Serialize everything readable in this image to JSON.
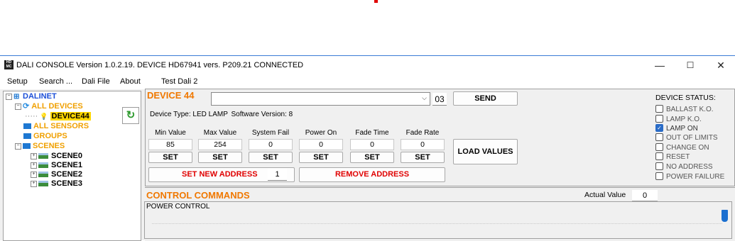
{
  "window": {
    "title": "DALI CONSOLE Version 1.0.2.19.  DEVICE HD67941     vers. P209.21 CONNECTED",
    "icon": "app-icon",
    "controls": {
      "minimize": "—",
      "maximize": "☐",
      "close": "✕"
    }
  },
  "menu": [
    "Setup",
    "Search ...",
    "Dali File",
    "About",
    "Test Dali 2"
  ],
  "tree": {
    "root": "DALINET",
    "all_devices": "ALL DEVICES",
    "device": "DEVICE44",
    "all_sensors": "ALL SENSORS",
    "groups": "GROUPS",
    "scenes": "SCENES",
    "scene_items": [
      "SCENE0",
      "SCENE1",
      "SCENE2",
      "SCENE3"
    ],
    "colors": {
      "root": "#1c4fd8",
      "group_label": "#f0a000",
      "selected_bg": "#ffd700"
    }
  },
  "device_panel": {
    "title": "DEVICE 44",
    "combo_value": "",
    "combo_number": "03",
    "send_label": "SEND",
    "device_type_label": "Device Type:",
    "device_type": "LED LAMP",
    "software_version_label": "Software Version:",
    "software_version": "8",
    "params": [
      {
        "label": "Min Value",
        "value": "85",
        "set": "SET"
      },
      {
        "label": "Max Value",
        "value": "254",
        "set": "SET"
      },
      {
        "label": "System Fail",
        "value": "0",
        "set": "SET"
      },
      {
        "label": "Power On",
        "value": "0",
        "set": "SET"
      },
      {
        "label": "Fade Time",
        "value": "0",
        "set": "SET"
      },
      {
        "label": "Fade Rate",
        "value": "0",
        "set": "SET"
      }
    ],
    "load_values_label": "LOAD VALUES",
    "set_new_address_label": "SET NEW ADDRESS",
    "new_address_value": "1",
    "remove_address_label": "REMOVE  ADDRESS",
    "accent_color": "#f07800",
    "danger_color": "#e00000"
  },
  "device_status": {
    "title": "DEVICE STATUS:",
    "items": [
      {
        "label": "BALLAST K.O.",
        "checked": false
      },
      {
        "label": "LAMP K.O.",
        "checked": false
      },
      {
        "label": "LAMP ON",
        "checked": true
      },
      {
        "label": "OUT OF LIMITS",
        "checked": false
      },
      {
        "label": "CHANGE ON",
        "checked": false
      },
      {
        "label": "RESET",
        "checked": false
      },
      {
        "label": "NO ADDRESS",
        "checked": false
      },
      {
        "label": "POWER FAILURE",
        "checked": false
      }
    ]
  },
  "control_commands": {
    "title": "CONTROL COMMANDS",
    "actual_value_label": "Actual Value",
    "actual_value": "0",
    "power_control_label": "POWER CONTROL",
    "slider_level": 1.0
  }
}
